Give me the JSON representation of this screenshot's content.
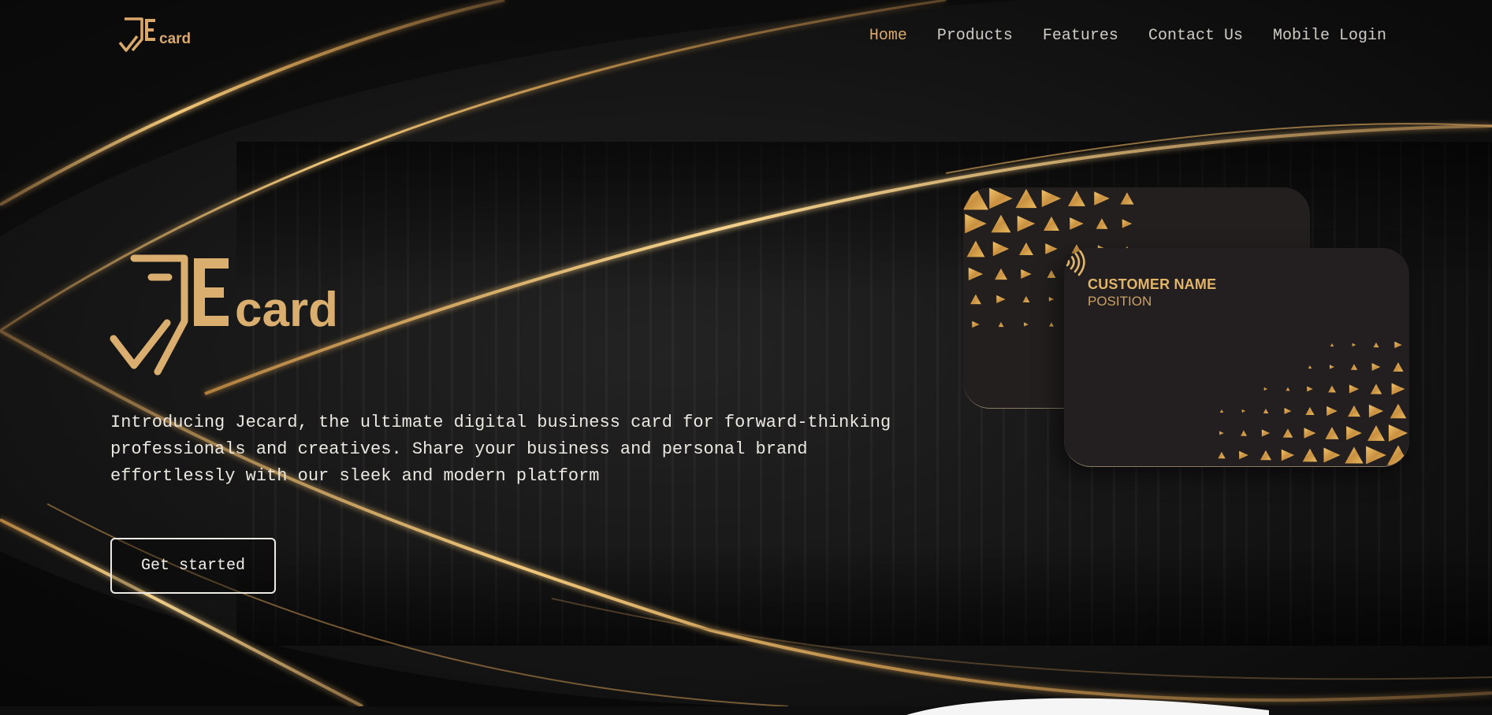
{
  "brand": {
    "logo_icon": "jecard-logo",
    "accent_color": "#d9a86a",
    "gold_light": "#f3cc7a",
    "gold_dark": "#b8853a"
  },
  "nav": {
    "items": [
      {
        "label": "Home",
        "active": true
      },
      {
        "label": "Products"
      },
      {
        "label": "Features"
      },
      {
        "label": "Contact Us"
      },
      {
        "label": "Mobile Login"
      }
    ]
  },
  "hero": {
    "intro": "Introducing Jecard, the ultimate digital business card for forward-thinking professionals and creatives. Share your business and personal brand effortlessly with our sleek and modern platform",
    "cta_label": "Get started"
  },
  "card_preview": {
    "customer_name": "CUSTOMER NAME",
    "position": "POSITION",
    "nfc_icon": "contactless-icon"
  }
}
